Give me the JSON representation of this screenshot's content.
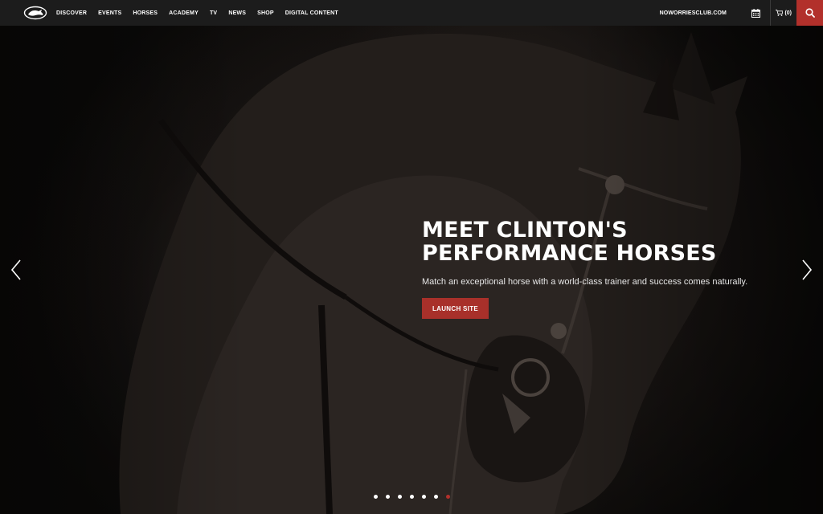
{
  "header": {
    "logo_icon": "kangaroo-logo-icon",
    "nav_items": [
      {
        "label": "DISCOVER"
      },
      {
        "label": "EVENTS"
      },
      {
        "label": "HORSES"
      },
      {
        "label": "ACADEMY"
      },
      {
        "label": "TV"
      },
      {
        "label": "NEWS"
      },
      {
        "label": "SHOP"
      },
      {
        "label": "DIGITAL CONTENT"
      }
    ],
    "club_link": "NOWORRIESCLUB.COM",
    "calendar_icon": "calendar-icon",
    "cart_icon": "cart-icon",
    "cart_count": "(0)",
    "search_icon": "search-icon"
  },
  "hero": {
    "headline_line1": "MEET CLINTON'S",
    "headline_line2": "PERFORMANCE HORSES",
    "subtext": "Match an exceptional horse with a world-class trainer and success comes naturally.",
    "cta_label": "LAUNCH SITE",
    "prev_icon": "chevron-left-icon",
    "next_icon": "chevron-right-icon"
  },
  "carousel": {
    "slide_count": 7,
    "active_index": 6
  },
  "colors": {
    "accent": "#b2302b",
    "nav_background": "#1c1c1c",
    "text": "#ffffff"
  }
}
